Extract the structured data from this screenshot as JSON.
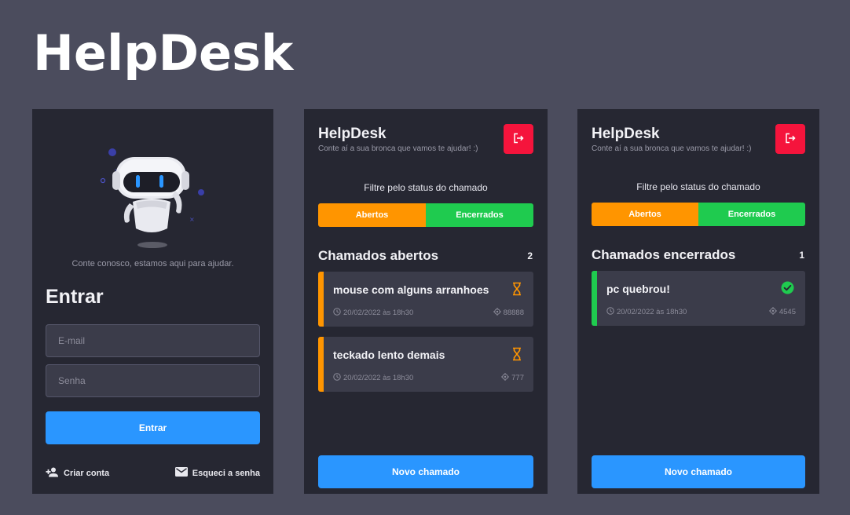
{
  "brand": "HelpDesk",
  "colors": {
    "background": "#4b4c5d",
    "panel": "#262732",
    "primary": "#2a96ff",
    "open": "#ff9500",
    "closed": "#1fcb4f",
    "logout": "#f5143c"
  },
  "login": {
    "tagline": "Conte conosco, estamos aqui para ajudar.",
    "title": "Entrar",
    "email_placeholder": "E-mail",
    "password_placeholder": "Senha",
    "submit_label": "Entrar",
    "create_account": {
      "label": "Criar conta",
      "icon": "add-user-icon"
    },
    "forgot_password": {
      "label": "Esqueci a senha",
      "icon": "mail-icon"
    }
  },
  "open_screen": {
    "title": "HelpDesk",
    "subtitle": "Conte aí a sua bronca que vamos te ajudar! :)",
    "logout_icon": "logout-icon",
    "filter_label": "Filtre pelo status do chamado",
    "filter_open": "Abertos",
    "filter_closed": "Encerrados",
    "list_heading": "Chamados abertos",
    "count": "2",
    "tickets": [
      {
        "title": "mouse com alguns arranhoes",
        "date": "20/02/2022 às 18h30",
        "id": "88888",
        "status_icon": "hourglass-icon"
      },
      {
        "title": "teckado lento demais",
        "date": "20/02/2022 às 18h30",
        "id": "777",
        "status_icon": "hourglass-icon"
      }
    ],
    "new_ticket_label": "Novo chamado"
  },
  "closed_screen": {
    "title": "HelpDesk",
    "subtitle": "Conte aí a sua bronca que vamos te ajudar! :)",
    "logout_icon": "logout-icon",
    "filter_label": "Filtre pelo status do chamado",
    "filter_open": "Abertos",
    "filter_closed": "Encerrados",
    "list_heading": "Chamados encerrados",
    "count": "1",
    "tickets": [
      {
        "title": "pc quebrou!",
        "date": "20/02/2022 às 18h30",
        "id": "4545",
        "status_icon": "check-circle-icon"
      }
    ],
    "new_ticket_label": "Novo chamado"
  }
}
